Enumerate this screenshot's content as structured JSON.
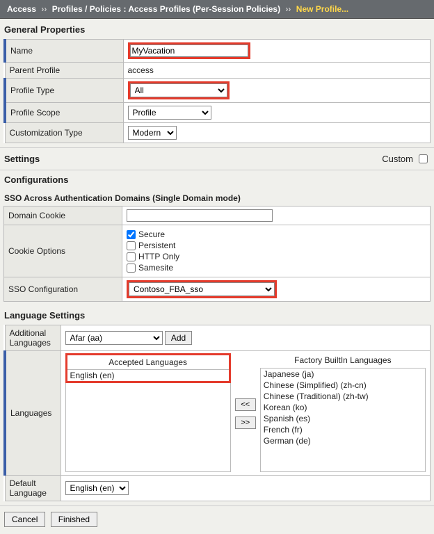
{
  "breadcrumb": {
    "root": "Access",
    "mid": "Profiles / Policies : Access Profiles (Per-Session Policies)",
    "current": "New Profile..."
  },
  "sections": {
    "general": "General Properties",
    "settings": "Settings",
    "custom_label": "Custom",
    "configurations": "Configurations",
    "sso": "SSO Across Authentication Domains (Single Domain mode)",
    "language": "Language Settings"
  },
  "fields": {
    "name_label": "Name",
    "name_value": "MyVacation",
    "parent_label": "Parent Profile",
    "parent_value": "access",
    "ptype_label": "Profile Type",
    "ptype_value": "All",
    "pscope_label": "Profile Scope",
    "pscope_value": "Profile",
    "ctype_label": "Customization Type",
    "ctype_value": "Modern",
    "dcookie_label": "Domain Cookie",
    "dcookie_value": "",
    "copts_label": "Cookie Options",
    "copt_secure": "Secure",
    "copt_persist": "Persistent",
    "copt_http": "HTTP Only",
    "copt_samesite": "Samesite",
    "sso_label": "SSO Configuration",
    "sso_value": "Contoso_FBA_sso",
    "addl_lang_label": "Additional Languages",
    "addl_lang_value": "Afar (aa)",
    "addl_lang_add": "Add",
    "languages_label": "Languages",
    "accepted_title": "Accepted Languages",
    "factory_title": "Factory BuiltIn Languages",
    "move_left": "<<",
    "move_right": ">>",
    "deflang_label": "Default Language",
    "deflang_value": "English (en)"
  },
  "accepted_langs": [
    "English (en)"
  ],
  "factory_langs": [
    "Japanese (ja)",
    "Chinese (Simplified) (zh-cn)",
    "Chinese (Traditional) (zh-tw)",
    "Korean (ko)",
    "Spanish (es)",
    "French (fr)",
    "German (de)"
  ],
  "buttons": {
    "cancel": "Cancel",
    "finished": "Finished"
  }
}
